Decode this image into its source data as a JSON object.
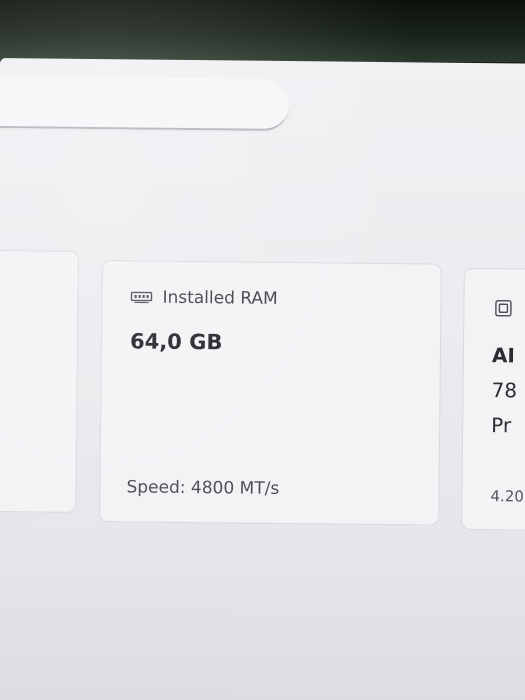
{
  "search": {
    "placeholder": ""
  },
  "ram_card": {
    "icon": "memory-icon",
    "title": "Installed RAM",
    "value": "64,0 GB",
    "footer": "Speed: 4800 MT/s"
  },
  "cpu_card": {
    "icon": "processor-icon",
    "line1": "AI",
    "line2": "78",
    "line3": "Pr",
    "footer": "4.20"
  },
  "colors": {
    "page_background": "#ecebef",
    "card_background": "#f3f2f5",
    "card_border": "#dad9de"
  }
}
